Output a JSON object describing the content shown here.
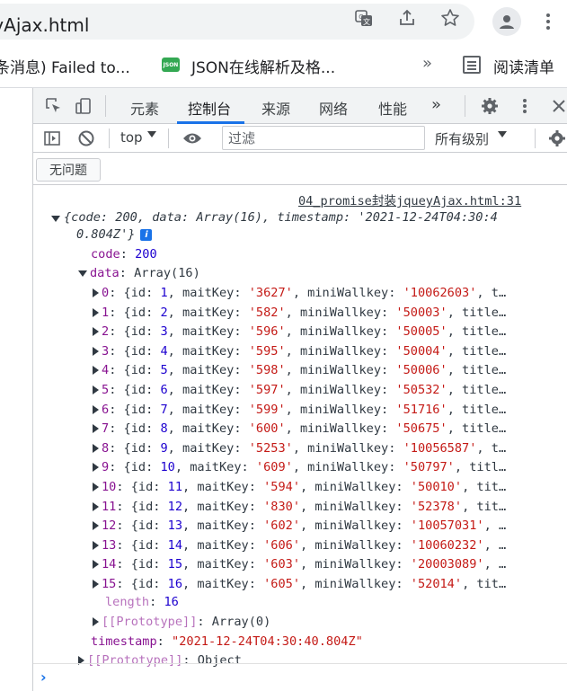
{
  "browser": {
    "url_text": "eyAjax.html",
    "bookmarks": [
      {
        "label": "条消息) Failed to..."
      },
      {
        "label": "JSON在线解析及格..."
      },
      {
        "label": "阅读清单"
      }
    ],
    "json_icon_text": "JSON",
    "more_chevron": "»"
  },
  "devtools": {
    "tabs": [
      {
        "label": "元素"
      },
      {
        "label": "控制台"
      },
      {
        "label": "来源"
      },
      {
        "label": "网络"
      },
      {
        "label": "性能"
      }
    ],
    "tabs_more": "»",
    "active_tab": "控制台",
    "context_selector": "top",
    "filter_placeholder": "过滤",
    "levels_label": "所有级别",
    "issues_button": "无问题"
  },
  "console": {
    "source_link": "04_promise封装jqueyAjax.html:31",
    "summary_line1": "{code: 200, data: Array(16), timestamp: '2021-12-24T04:30:4",
    "summary_line2": "0.804Z'}",
    "code_key": "code",
    "code_value": "200",
    "data_key": "data",
    "data_value": "Array(16)",
    "items": [
      {
        "index": "0",
        "id": "1",
        "maitKey": "'3627'",
        "miniWallkey": "'10062603'",
        "tail": ", t…"
      },
      {
        "index": "1",
        "id": "2",
        "maitKey": "'582'",
        "miniWallkey": "'50003'",
        "tail": ", title…"
      },
      {
        "index": "2",
        "id": "3",
        "maitKey": "'596'",
        "miniWallkey": "'50005'",
        "tail": ", title…"
      },
      {
        "index": "3",
        "id": "4",
        "maitKey": "'595'",
        "miniWallkey": "'50004'",
        "tail": ", title…"
      },
      {
        "index": "4",
        "id": "5",
        "maitKey": "'598'",
        "miniWallkey": "'50006'",
        "tail": ", title…"
      },
      {
        "index": "5",
        "id": "6",
        "maitKey": "'597'",
        "miniWallkey": "'50532'",
        "tail": ", title…"
      },
      {
        "index": "6",
        "id": "7",
        "maitKey": "'599'",
        "miniWallkey": "'51716'",
        "tail": ", title…"
      },
      {
        "index": "7",
        "id": "8",
        "maitKey": "'600'",
        "miniWallkey": "'50675'",
        "tail": ", title…"
      },
      {
        "index": "8",
        "id": "9",
        "maitKey": "'5253'",
        "miniWallkey": "'10056587'",
        "tail": ", t…"
      },
      {
        "index": "9",
        "id": "10",
        "maitKey": "'609'",
        "miniWallkey": "'50797'",
        "tail": ", titl…"
      },
      {
        "index": "10",
        "id": "11",
        "maitKey": "'594'",
        "miniWallkey": "'50010'",
        "tail": ", tit…"
      },
      {
        "index": "11",
        "id": "12",
        "maitKey": "'830'",
        "miniWallkey": "'52378'",
        "tail": ", tit…"
      },
      {
        "index": "12",
        "id": "13",
        "maitKey": "'602'",
        "miniWallkey": "'10057031'",
        "tail": ", …"
      },
      {
        "index": "13",
        "id": "14",
        "maitKey": "'606'",
        "miniWallkey": "'10060232'",
        "tail": ", …"
      },
      {
        "index": "14",
        "id": "15",
        "maitKey": "'603'",
        "miniWallkey": "'20003089'",
        "tail": ", …"
      },
      {
        "index": "15",
        "id": "16",
        "maitKey": "'605'",
        "miniWallkey": "'52014'",
        "tail": ", tit…"
      }
    ],
    "length_key": "length",
    "length_value": "16",
    "proto_key": "[[Prototype]]",
    "array_proto_value": "Array(0)",
    "timestamp_key": "timestamp",
    "timestamp_value": "\"2021-12-24T04:30:40.804Z\"",
    "object_proto_value": "Object",
    "prompt": "›"
  },
  "colors": {
    "key_purple": "#881391",
    "number_blue": "#1c00cf",
    "string_red": "#c41a16",
    "accent_blue": "#1a73e8"
  }
}
